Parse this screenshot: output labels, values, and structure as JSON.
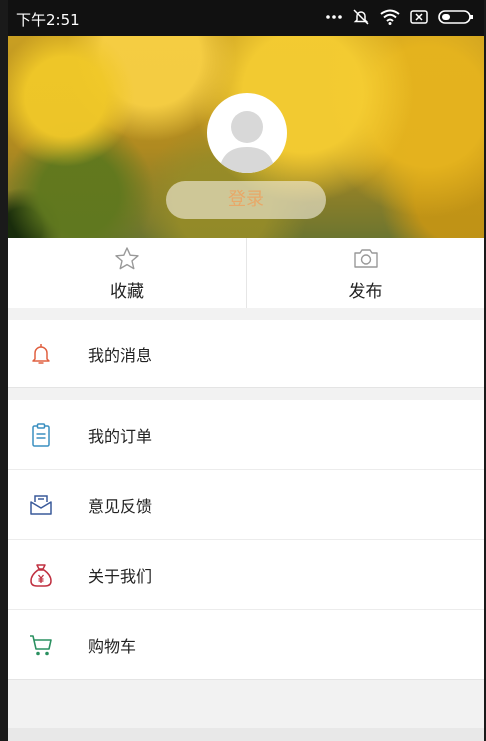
{
  "status_bar": {
    "time": "下午2:51",
    "icons": [
      "more-dots-icon",
      "mute-bell-icon",
      "wifi-icon",
      "sim-icon",
      "battery-icon"
    ]
  },
  "header": {
    "avatar_icon": "avatar-placeholder-icon",
    "login_label": "登录"
  },
  "actions": [
    {
      "label": "收藏",
      "icon": "star-icon"
    },
    {
      "label": "发布",
      "icon": "camera-icon"
    }
  ],
  "menu": {
    "group1": [
      {
        "label": "我的消息",
        "icon": "bell-icon"
      }
    ],
    "group2": [
      {
        "label": "我的订单",
        "icon": "clipboard-icon"
      },
      {
        "label": "意见反馈",
        "icon": "envelope-icon"
      },
      {
        "label": "关于我们",
        "icon": "money-bag-icon"
      },
      {
        "label": "购物车",
        "icon": "cart-icon"
      }
    ]
  },
  "colors": {
    "login_text": "#e8a868",
    "bell": "#e06040",
    "clipboard": "#3a8fc0",
    "envelope": "#3a5a9a",
    "money_bag": "#c03040",
    "cart": "#2a9060"
  }
}
